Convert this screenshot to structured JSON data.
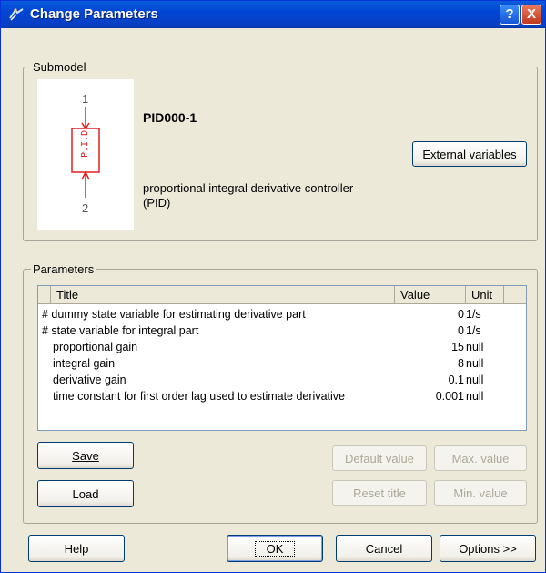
{
  "window": {
    "title": "Change Parameters",
    "help_glyph": "?",
    "close_glyph": "X"
  },
  "submodel": {
    "group_label": "Submodel",
    "symbol_top_port": "1",
    "symbol_bottom_port": "2",
    "symbol_text": "P.I.D.",
    "name": "PID000-1",
    "description_line1": "proportional integral derivative controller",
    "description_line2": "(PID)",
    "external_variables_button": "External variables"
  },
  "parameters": {
    "group_label": "Parameters",
    "columns": {
      "title": "Title",
      "value": "Value",
      "unit": "Unit"
    },
    "rows": [
      {
        "title": "# dummy state variable for estimating derivative part",
        "value": "0",
        "unit": "1/s"
      },
      {
        "title": "# state variable for integral part",
        "value": "0",
        "unit": "1/s"
      },
      {
        "title": "  proportional gain",
        "value": "15",
        "unit": "null"
      },
      {
        "title": "  integral gain",
        "value": "8",
        "unit": "null"
      },
      {
        "title": "  derivative gain",
        "value": "0.1",
        "unit": "null"
      },
      {
        "title": "  time constant for first order lag used to estimate derivative",
        "value": "0.001",
        "unit": "null"
      }
    ],
    "save_button": "Save",
    "load_button": "Load",
    "default_value_button": "Default value",
    "max_value_button": "Max. value",
    "reset_title_button": "Reset title",
    "min_value_button": "Min. value"
  },
  "footer": {
    "help_button": "Help",
    "ok_button": "OK",
    "cancel_button": "Cancel",
    "options_button": "Options >>"
  },
  "colors": {
    "titlebar": "#0046d5",
    "symbol_red": "#e02020",
    "disabled_text": "#aca899"
  }
}
